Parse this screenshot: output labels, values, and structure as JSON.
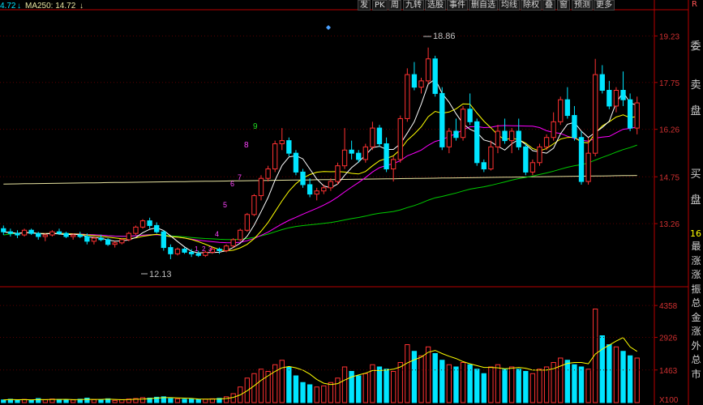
{
  "toolbar": {
    "items": [
      "发",
      "PK",
      "周",
      "九转",
      "选股",
      "事件",
      "删自选",
      "均线",
      "除权",
      "叠",
      "窗",
      "预测",
      "更多"
    ],
    "right_glyph": "R"
  },
  "ma_legend": {
    "ma_cut_value": "4.72",
    "ma250_label": "MA250: 14.72"
  },
  "price_axis": [
    "19.23",
    "17.75",
    "16.26",
    "14.75",
    "13.26"
  ],
  "volume_axis": [
    "4358",
    "2926",
    "1463",
    "X100"
  ],
  "annotations": {
    "high_label": "18.86",
    "low_label": "12.13",
    "markers": [
      "9",
      "8",
      "7",
      "6",
      "5",
      "4",
      "3",
      "2",
      "1"
    ]
  },
  "side_panel": {
    "top_labels": [
      "委",
      "卖",
      "盘",
      "买",
      "盘"
    ],
    "stat_label": "16",
    "vertical_text": "最涨涨振总金涨外总市"
  },
  "colors": {
    "up": "#ff3232",
    "down": "#00e5ff",
    "ma5": "#ffffff",
    "ma10": "#ffff00",
    "ma20": "#ff00ff",
    "ma60": "#00cc00",
    "ma250": "#e8e4a0",
    "axis": "#b80000",
    "grid": "#5a0000"
  },
  "chart_data": {
    "type": "candlestick",
    "ylim": [
      12.0,
      19.6
    ],
    "volume_max": 4800,
    "candles": [
      [
        13.1,
        13.2,
        12.9,
        13.0
      ],
      [
        13.0,
        13.1,
        12.85,
        12.95
      ],
      [
        12.95,
        13.05,
        12.8,
        12.9
      ],
      [
        12.9,
        13.1,
        12.85,
        13.05
      ],
      [
        13.05,
        13.1,
        12.9,
        12.95
      ],
      [
        12.95,
        13.0,
        12.75,
        12.85
      ],
      [
        12.85,
        12.95,
        12.7,
        12.9
      ],
      [
        12.9,
        13.05,
        12.85,
        13.0
      ],
      [
        13.0,
        13.1,
        12.9,
        12.95
      ],
      [
        12.95,
        13.0,
        12.8,
        12.85
      ],
      [
        12.85,
        12.95,
        12.75,
        12.9
      ],
      [
        12.9,
        13.0,
        12.8,
        12.85
      ],
      [
        12.85,
        12.95,
        12.6,
        12.7
      ],
      [
        12.7,
        12.85,
        12.6,
        12.8
      ],
      [
        12.8,
        12.9,
        12.7,
        12.75
      ],
      [
        12.75,
        12.8,
        12.55,
        12.6
      ],
      [
        12.6,
        12.7,
        12.5,
        12.65
      ],
      [
        12.65,
        12.8,
        12.6,
        12.75
      ],
      [
        12.75,
        13.0,
        12.7,
        12.95
      ],
      [
        12.95,
        13.2,
        12.9,
        13.15
      ],
      [
        13.15,
        13.4,
        13.1,
        13.35
      ],
      [
        13.35,
        13.45,
        13.1,
        13.2
      ],
      [
        13.2,
        13.3,
        12.95,
        13.0
      ],
      [
        13.0,
        13.05,
        12.4,
        12.5
      ],
      [
        12.5,
        12.6,
        12.13,
        12.3
      ],
      [
        12.3,
        12.5,
        12.25,
        12.45
      ],
      [
        12.45,
        12.5,
        12.3,
        12.35
      ],
      [
        12.35,
        12.45,
        12.2,
        12.3
      ],
      [
        12.3,
        12.4,
        12.2,
        12.25
      ],
      [
        12.25,
        12.4,
        12.2,
        12.35
      ],
      [
        12.35,
        12.5,
        12.3,
        12.45
      ],
      [
        12.45,
        12.5,
        12.3,
        12.4
      ],
      [
        12.4,
        12.6,
        12.35,
        12.55
      ],
      [
        12.55,
        12.8,
        12.5,
        12.75
      ],
      [
        12.75,
        13.1,
        12.7,
        13.05
      ],
      [
        13.05,
        13.6,
        13.0,
        13.55
      ],
      [
        13.55,
        14.2,
        13.5,
        14.15
      ],
      [
        14.15,
        14.8,
        14.0,
        14.7
      ],
      [
        14.7,
        15.1,
        14.6,
        15.0
      ],
      [
        15.0,
        15.9,
        14.9,
        15.8
      ],
      [
        15.8,
        16.3,
        15.6,
        15.9
      ],
      [
        15.9,
        16.0,
        15.4,
        15.5
      ],
      [
        15.5,
        15.6,
        14.8,
        14.9
      ],
      [
        14.9,
        15.0,
        14.4,
        14.5
      ],
      [
        14.5,
        14.7,
        14.1,
        14.2
      ],
      [
        14.2,
        14.4,
        14.0,
        14.3
      ],
      [
        14.3,
        14.5,
        14.2,
        14.4
      ],
      [
        14.4,
        14.7,
        14.3,
        14.6
      ],
      [
        14.6,
        15.2,
        14.5,
        15.1
      ],
      [
        15.1,
        16.3,
        15.0,
        15.6
      ],
      [
        15.6,
        15.9,
        15.3,
        15.5
      ],
      [
        15.5,
        15.6,
        15.2,
        15.3
      ],
      [
        15.3,
        15.8,
        15.2,
        15.7
      ],
      [
        15.7,
        16.5,
        15.6,
        16.3
      ],
      [
        16.3,
        16.4,
        15.7,
        15.8
      ],
      [
        15.8,
        16.0,
        14.9,
        15.0
      ],
      [
        15.0,
        15.4,
        14.6,
        15.3
      ],
      [
        15.3,
        16.7,
        15.2,
        16.6
      ],
      [
        16.6,
        18.2,
        16.5,
        18.0
      ],
      [
        18.0,
        18.4,
        17.5,
        17.6
      ],
      [
        17.6,
        17.9,
        17.4,
        17.8
      ],
      [
        17.8,
        18.86,
        17.7,
        18.5
      ],
      [
        18.5,
        18.6,
        17.3,
        17.4
      ],
      [
        17.4,
        17.6,
        15.6,
        15.7
      ],
      [
        15.7,
        16.3,
        15.5,
        16.2
      ],
      [
        16.2,
        16.6,
        15.9,
        16.0
      ],
      [
        16.0,
        17.0,
        15.9,
        16.9
      ],
      [
        16.9,
        17.4,
        16.4,
        16.5
      ],
      [
        16.5,
        16.6,
        15.1,
        15.2
      ],
      [
        15.2,
        15.3,
        14.9,
        15.0
      ],
      [
        15.0,
        15.9,
        14.95,
        15.7
      ],
      [
        15.7,
        16.4,
        15.5,
        16.2
      ],
      [
        16.2,
        16.6,
        15.8,
        15.9
      ],
      [
        15.9,
        16.3,
        15.5,
        16.2
      ],
      [
        16.2,
        16.6,
        15.6,
        15.7
      ],
      [
        15.7,
        15.8,
        14.8,
        14.9
      ],
      [
        14.9,
        15.3,
        14.8,
        15.2
      ],
      [
        15.2,
        15.8,
        15.1,
        15.7
      ],
      [
        15.7,
        16.1,
        15.6,
        16.0
      ],
      [
        16.0,
        16.8,
        15.9,
        16.5
      ],
      [
        16.5,
        17.3,
        16.4,
        17.2
      ],
      [
        17.2,
        17.6,
        16.6,
        16.7
      ],
      [
        16.7,
        17.0,
        15.9,
        16.0
      ],
      [
        16.0,
        16.2,
        14.5,
        14.6
      ],
      [
        14.6,
        16.0,
        14.5,
        15.5
      ],
      [
        15.5,
        18.5,
        15.4,
        18.0
      ],
      [
        18.0,
        18.3,
        17.4,
        17.5
      ],
      [
        17.5,
        17.8,
        16.9,
        17.0
      ],
      [
        17.0,
        17.6,
        16.8,
        17.5
      ],
      [
        17.5,
        18.1,
        17.0,
        17.2
      ],
      [
        17.2,
        17.4,
        16.2,
        16.3
      ],
      [
        16.3,
        17.3,
        16.1,
        17.1
      ]
    ],
    "volume": [
      120,
      150,
      110,
      140,
      100,
      180,
      130,
      160,
      140,
      110,
      120,
      150,
      200,
      130,
      110,
      170,
      100,
      130,
      160,
      180,
      220,
      200,
      240,
      260,
      180,
      170,
      150,
      160,
      140,
      150,
      170,
      190,
      260,
      400,
      700,
      1100,
      1300,
      1500,
      1400,
      1700,
      1900,
      1600,
      1200,
      900,
      800,
      700,
      750,
      900,
      1100,
      1600,
      1400,
      1200,
      1300,
      1700,
      1600,
      1500,
      1400,
      1800,
      2600,
      2300,
      2100,
      2500,
      2200,
      1900,
      1700,
      1600,
      1800,
      1700,
      1500,
      1300,
      1600,
      1700,
      1500,
      1600,
      1500,
      1400,
      1300,
      1500,
      1600,
      1800,
      2000,
      1900,
      1700,
      1600,
      1500,
      4200,
      3000,
      2600,
      2500,
      2300,
      2100,
      2000
    ],
    "ma250": 14.72
  }
}
